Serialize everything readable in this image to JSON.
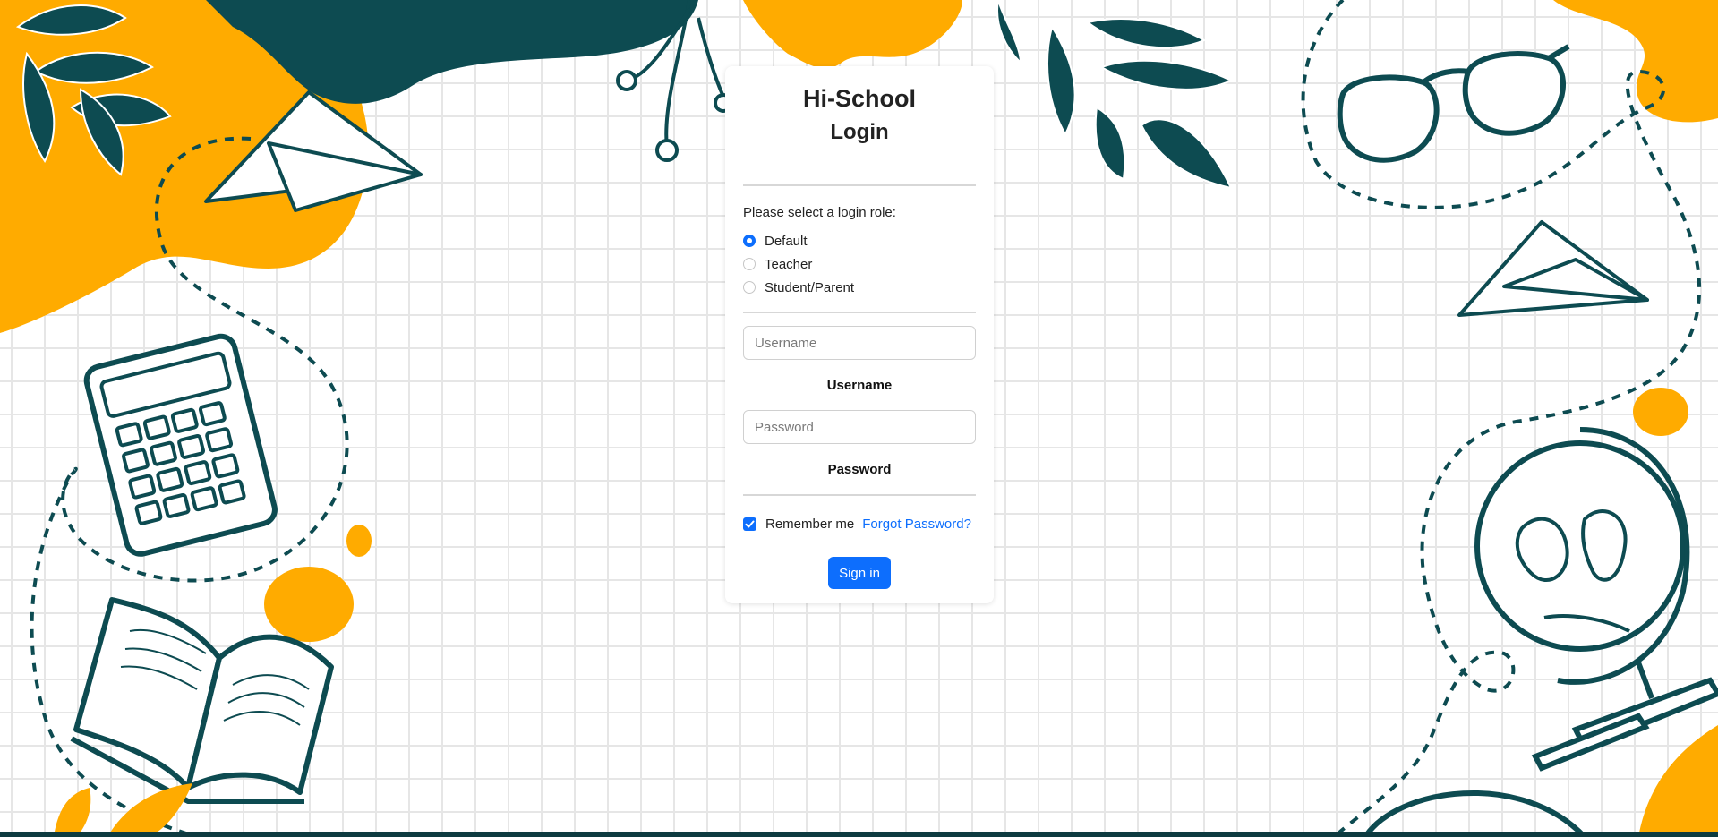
{
  "app": {
    "title": "Hi-School",
    "subtitle": "Login"
  },
  "role": {
    "prompt": "Please select a login role:",
    "options": [
      {
        "label": "Default",
        "selected": true
      },
      {
        "label": "Teacher",
        "selected": false
      },
      {
        "label": "Student/Parent",
        "selected": false
      }
    ]
  },
  "username": {
    "placeholder": "Username",
    "value": "",
    "label": "Username"
  },
  "password": {
    "placeholder": "Password",
    "value": "",
    "label": "Password"
  },
  "remember": {
    "label": "Remember me",
    "checked": true
  },
  "forgot": {
    "label": "Forgot Password?"
  },
  "signin": {
    "label": "Sign in"
  },
  "colors": {
    "accent": "#0d6efd",
    "teal": "#0d4b51",
    "orange": "#ffab00",
    "grid": "#e6e6e6"
  }
}
